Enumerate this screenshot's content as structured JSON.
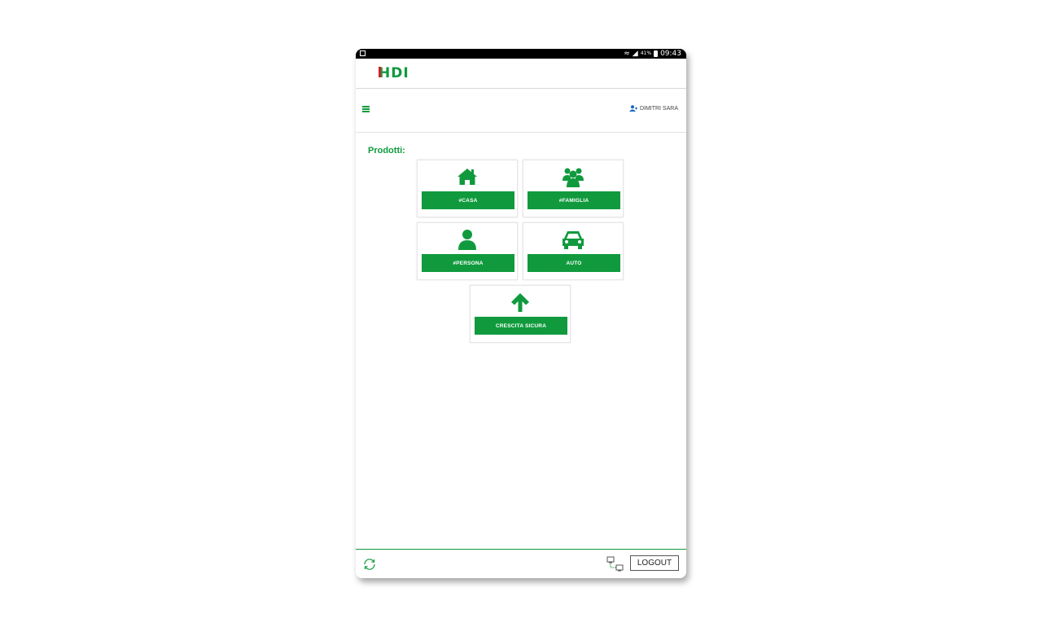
{
  "status_bar": {
    "signal_percent": "41%",
    "time": "09:43"
  },
  "header": {
    "logo_text": "HDI"
  },
  "toolbar": {
    "menu_icon": "hamburger-icon",
    "user_icon": "user-icon",
    "user_name": "DIMITRI SARA"
  },
  "main": {
    "section_title": "Prodotti:",
    "products": [
      {
        "icon": "home-icon",
        "label": "#CASA"
      },
      {
        "icon": "family-icon",
        "label": "#FAMIGLIA"
      },
      {
        "icon": "person-icon",
        "label": "#PERSONA"
      },
      {
        "icon": "car-icon",
        "label": "AUTO"
      },
      {
        "icon": "arrow-up-icon",
        "label": "CRESCITA SICURA"
      }
    ]
  },
  "footer": {
    "sync_icon": "sync-icon",
    "network_icon": "network-icon",
    "logout_label": "LOGOUT"
  },
  "colors": {
    "brand_green": "#109a3d",
    "brand_red": "#d6202a"
  }
}
